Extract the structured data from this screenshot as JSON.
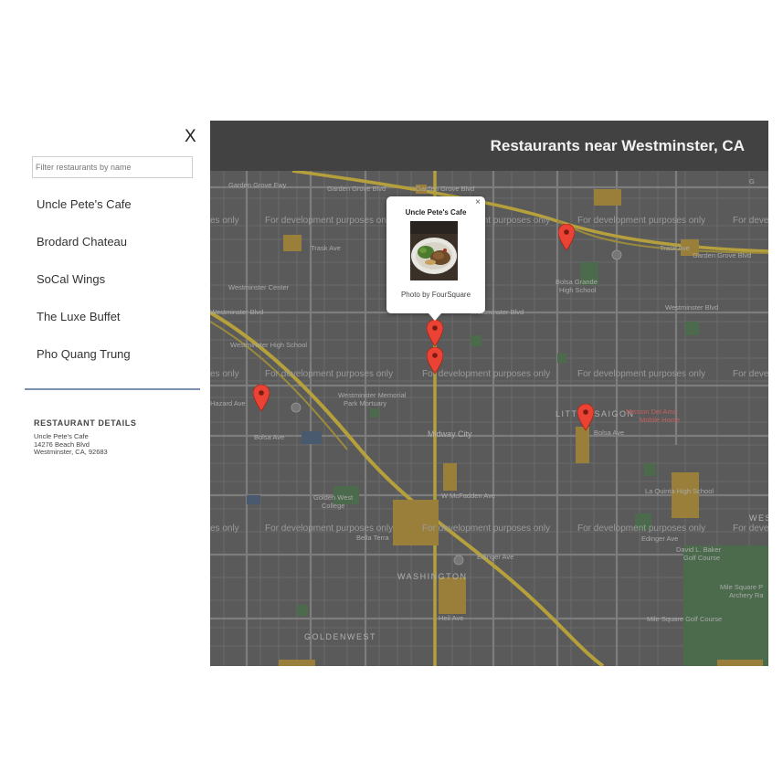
{
  "sidebar": {
    "close_label": "X",
    "filter_placeholder": "Filter restaurants by name",
    "restaurants": [
      "Uncle Pete's Cafe",
      "Brodard Chateau",
      "SoCal Wings",
      "The Luxe Buffet",
      "Pho Quang Trung"
    ],
    "details_title": "RESTAURANT DETAILS",
    "details": {
      "name": "Uncle Pete's Cafe",
      "address": "14276 Beach Blvd",
      "city": "Westminster, CA, 92683"
    }
  },
  "map": {
    "header_title": "Restaurants near Westminster, CA",
    "watermark": "For development purposes only",
    "watermark_cut": "es only",
    "watermark_tail": "For deve",
    "labels": {
      "garden_grove_fwy": "Garden Grove Fwy",
      "garden_grove_blvd": "Garden Grove Blvd",
      "garden_grove_blvd_2": "Garden Grove Blvd",
      "garden_grove_blvd_3": "Garden Grove Blvd",
      "trask_ave": "Trask Ave",
      "trask_ave_2": "Trask Ave",
      "westminster_center": "Westminster Center",
      "bolsa_grande": "Bolsa Grande",
      "bolsa_grande_2": "High School",
      "westminster_blvd": "Westminster Blvd",
      "westminster_blvd_2": "Westminster Blvd",
      "westminster_blvd_3": "Westminster Blvd",
      "westminster_hs": "Westminster High School",
      "hazard_ave": "Hazard Ave",
      "westminster_memorial": "Westminster Memorial",
      "park_mortuary": "Park Mortuary",
      "little_saigon": "LITTLE SAIGON",
      "mission_del_amo": "Mission Del Amo",
      "mobile_home": "Mobile Home",
      "midway_city": "Midway City",
      "bolsa_ave": "Bolsa Ave",
      "bolsa_ave_2": "Bolsa Ave",
      "la_quinta": "La Quinta High School",
      "mcfadden_ave": "W McFadden Ave",
      "golden_west_college": "Golden West",
      "golden_west_college_2": "College",
      "bella_terra": "Bella Terra",
      "edinger_ave": "Edinger Ave",
      "edinger_ave_2": "Edinger Ave",
      "david_l_baker": "David L. Baker",
      "golf_course": "Golf Course",
      "washington": "WASHINGTON",
      "mile_square_park": "Mile Square P",
      "archery_range": "Archery Ra",
      "mile_square_golf": "Mile Square Golf Course",
      "goldenwest": "GOLDENWEST",
      "heil_ave": "Heil Ave",
      "gothard": "G",
      "wes": "WES"
    }
  },
  "info_window": {
    "title": "Uncle Pete's Cafe",
    "close_label": "×",
    "photo_credit": "Photo by FourSquare"
  },
  "colors": {
    "header_bg": "#424242",
    "map_bg": "#595959",
    "marker": "#ea4335",
    "divider": "#7b90b0"
  }
}
